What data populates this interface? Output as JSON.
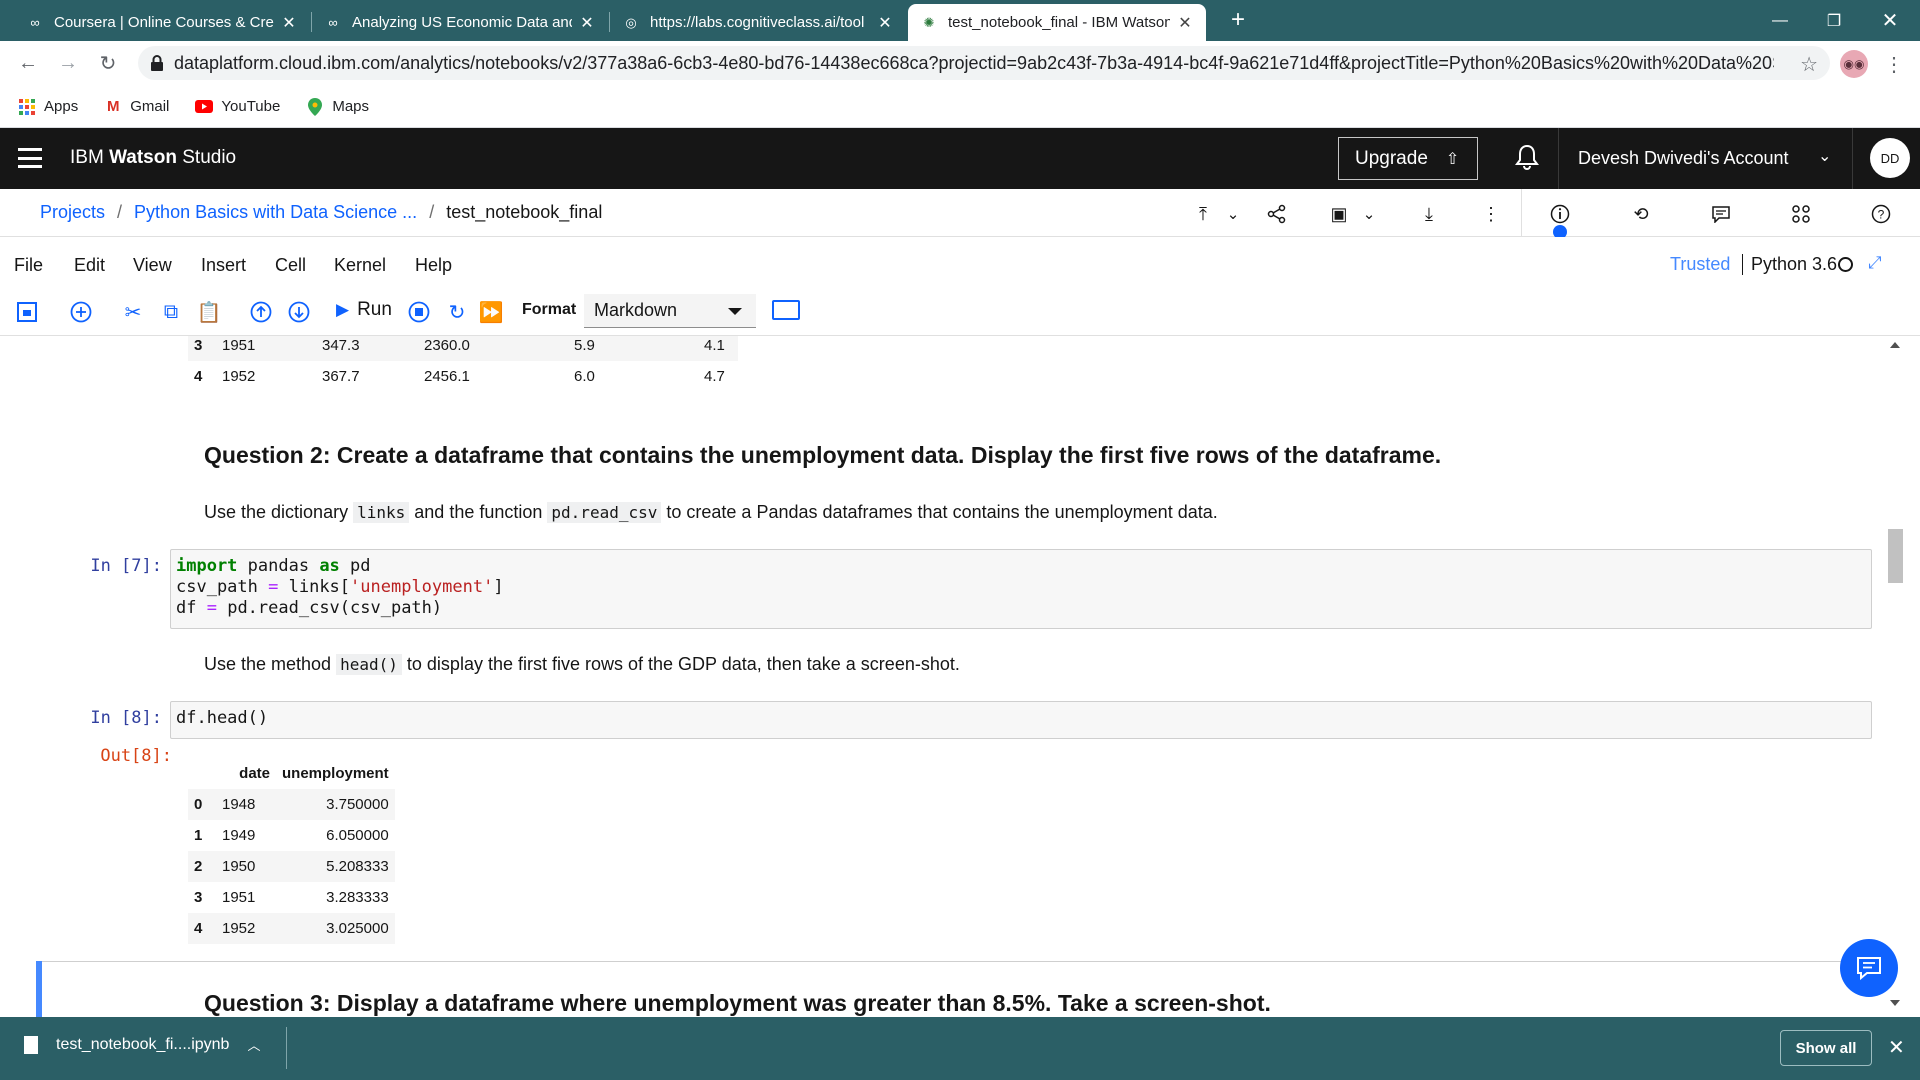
{
  "browser": {
    "tabs": [
      {
        "title": "Coursera | Online Courses & Cre",
        "icon": "coursera-icon",
        "active": false
      },
      {
        "title": "Analyzing US Economic Data and",
        "icon": "coursera-icon",
        "active": false
      },
      {
        "title": "https://labs.cognitiveclass.ai/tool",
        "icon": "globe-icon",
        "active": false
      },
      {
        "title": "test_notebook_final - IBM Watson",
        "icon": "watson-icon",
        "active": true
      }
    ],
    "url": "dataplatform.cloud.ibm.com/analytics/notebooks/v2/377a38a6-6cb3-4e80-bd76-14438ec668ca?projectid=9ab2c43f-7b3a-4914-bc4f-9a621e71d4ff&projectTitle=Python%20Basics%20with%20Data%20Scie...",
    "bookmarks": [
      {
        "label": "Apps",
        "icon": "apps-grid-icon"
      },
      {
        "label": "Gmail",
        "icon": "gmail-icon"
      },
      {
        "label": "YouTube",
        "icon": "youtube-icon"
      },
      {
        "label": "Maps",
        "icon": "maps-icon"
      }
    ]
  },
  "header": {
    "brand_light": "IBM",
    "brand_bold": "Watson",
    "brand_rest": "Studio",
    "upgrade_label": "Upgrade",
    "account_label": "Devesh Dwivedi's Account",
    "avatar_initials": "DD"
  },
  "breadcrumb": {
    "projects": "Projects",
    "project": "Python Basics with Data Science ...",
    "notebook": "test_notebook_final",
    "sep": "/"
  },
  "menu": {
    "items": [
      "File",
      "Edit",
      "View",
      "Insert",
      "Cell",
      "Kernel",
      "Help"
    ],
    "trusted": "Trusted",
    "kernel": "Python 3.6"
  },
  "toolbar": {
    "run_label": "Run",
    "format_label": "Format",
    "format_value": "Markdown"
  },
  "notebook": {
    "top_table": {
      "rows": [
        [
          "3",
          "1951",
          "347.3",
          "2360.0",
          "5.9",
          "4.1"
        ],
        [
          "4",
          "1952",
          "367.7",
          "2456.1",
          "6.0",
          "4.7"
        ]
      ]
    },
    "q2_heading": "Question 2: Create a dataframe that contains the unemployment data. Display the first five rows of the dataframe.",
    "q2_text": {
      "p1": "Use the dictionary",
      "code1": "links",
      "p2": "and the function",
      "code2": "pd.read_csv",
      "p3": "to create a Pandas dataframes that contains the unemployment data."
    },
    "cell7": {
      "prompt": "In [7]:",
      "line1_kw": "import",
      "line1_a": " pandas ",
      "line1_kw2": "as",
      "line1_b": " pd",
      "line2_a": "csv_path ",
      "line2_op": "=",
      "line2_b": " links[",
      "line2_str": "'unemployment'",
      "line2_c": "]",
      "line3_a": "df ",
      "line3_op": "=",
      "line3_b": " pd.read_csv(csv_path)"
    },
    "head_text": {
      "p1": "Use the method",
      "code1": "head()",
      "p2": "to display the first five rows of the GDP data, then take a screen-shot."
    },
    "cell8": {
      "prompt": "In [8]:",
      "code": "df.head()",
      "out_prompt": "Out[8]:"
    },
    "out_table": {
      "columns": [
        "date",
        "unemployment"
      ],
      "rows": [
        [
          "0",
          "1948",
          "3.750000"
        ],
        [
          "1",
          "1949",
          "6.050000"
        ],
        [
          "2",
          "1950",
          "5.208333"
        ],
        [
          "3",
          "1951",
          "3.283333"
        ],
        [
          "4",
          "1952",
          "3.025000"
        ]
      ]
    },
    "q3_heading": "Question 3: Display a dataframe where unemployment was greater than 8.5%. Take a screen-shot."
  },
  "downloads": {
    "file": "test_notebook_fi....ipynb",
    "show_all": "Show all"
  },
  "colors": {
    "chrome_frame": "#2b5f66",
    "watson_header": "#161616",
    "ibm_blue": "#0f62fe"
  }
}
